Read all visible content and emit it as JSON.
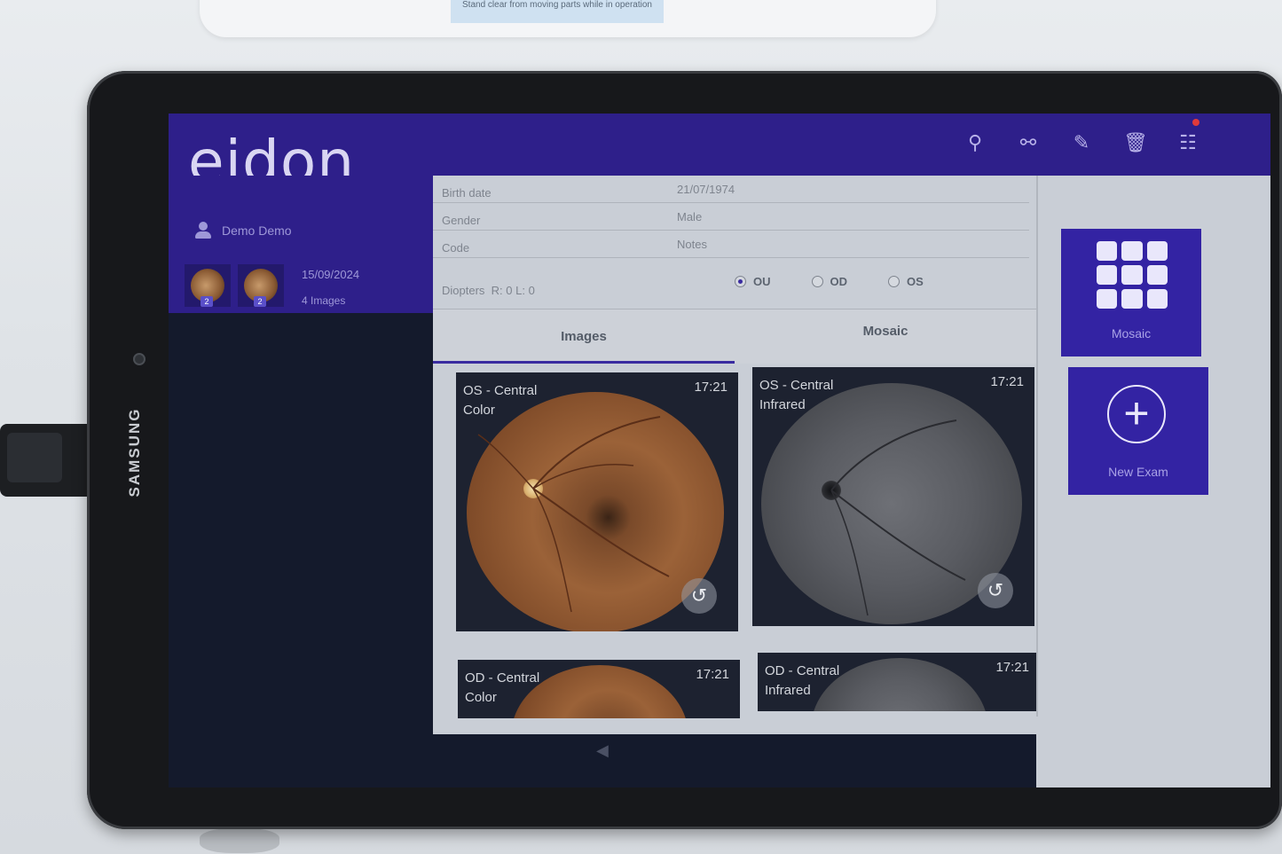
{
  "device": {
    "brand": "SAMSUNG",
    "stand_label": "Stand clear from moving parts while in operation"
  },
  "app": {
    "logo": "eidon"
  },
  "toolbar": {
    "icons": [
      "share-icon",
      "link-icon",
      "pencil-icon",
      "trash-icon",
      "settings-grid-icon"
    ]
  },
  "patient": {
    "name": "Demo Demo"
  },
  "exam": {
    "date": "15/09/2024",
    "image_count": "4 Images",
    "thumb_counts": [
      "2",
      "2"
    ]
  },
  "info": {
    "birth_date_label": "Birth date",
    "birth_date_value": "21/07/1974",
    "gender_label": "Gender",
    "gender_value": "Male",
    "code_label": "Code",
    "notes_label": "Notes",
    "diopters_label": "Diopters",
    "diopters_value": "R: 0   L: 0"
  },
  "eye_select": {
    "options": [
      "OU",
      "OD",
      "OS"
    ],
    "selected": "OU"
  },
  "tabs": {
    "images": "Images",
    "mosaic": "Mosaic",
    "active": "Images"
  },
  "images": [
    {
      "title": "OS - Central",
      "mode": "Color",
      "time": "17:21"
    },
    {
      "title": "OS - Central",
      "mode": "Infrared",
      "time": "17:21"
    },
    {
      "title": "OD - Central",
      "mode": "Color",
      "time": "17:21"
    },
    {
      "title": "OD - Central",
      "mode": "Infrared",
      "time": "17:21"
    }
  ],
  "side": {
    "mosaic_label": "Mosaic",
    "new_exam_label": "New Exam"
  },
  "colors": {
    "accent": "#2e1f8a",
    "tile": "#3323a3",
    "panel": "#c9ced6"
  }
}
